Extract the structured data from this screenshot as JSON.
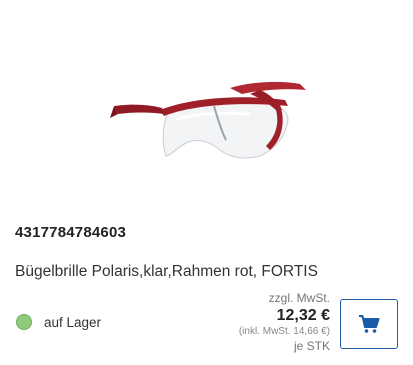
{
  "product": {
    "sku": "4317784784603",
    "title": "Bügelbrille Polaris,klar,Rahmen rot, FORTIS",
    "image_icon": "safety-glasses-red-frame"
  },
  "stock": {
    "label": "auf Lager",
    "color": "#8fc97c"
  },
  "price": {
    "tax_note": "zzgl. MwSt.",
    "value": "12,32 €",
    "incl_note": "(inkl. MwSt. 14,66 €)",
    "unit": "je STK"
  },
  "cart": {
    "icon": "shopping-cart-icon",
    "color": "#1a5ca8"
  }
}
